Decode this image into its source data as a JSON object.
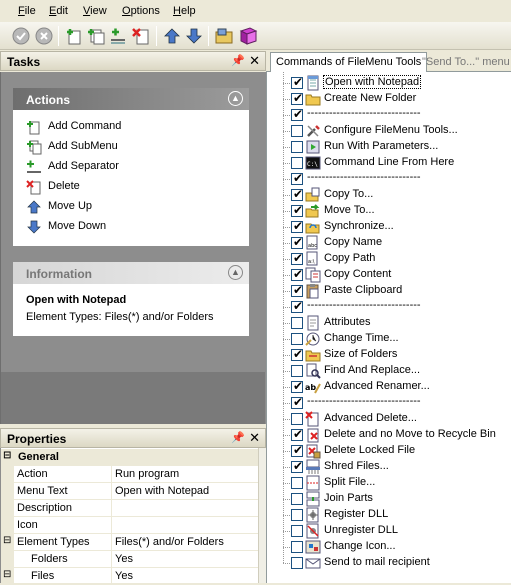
{
  "menu": {
    "items": [
      {
        "accel": "F",
        "rest": "ile"
      },
      {
        "accel": "E",
        "rest": "dit"
      },
      {
        "accel": "V",
        "rest": "iew"
      },
      {
        "accel": "O",
        "rest": "ptions"
      },
      {
        "accel": "H",
        "rest": "elp"
      }
    ]
  },
  "toolbar": {
    "buttons": [
      "apply-icon",
      "cancel-icon",
      "add-command-icon",
      "add-submenu-icon",
      "add-separator-icon",
      "delete-icon",
      "move-up-icon",
      "move-down-icon",
      "explorer-icon",
      "help-book-icon"
    ]
  },
  "tasks": {
    "title": "Tasks",
    "actions": {
      "title": "Actions",
      "items": [
        "Add Command",
        "Add SubMenu",
        "Add Separator",
        "Delete",
        "Move Up",
        "Move Down"
      ]
    },
    "information": {
      "title": "Information",
      "element_name": "Open with Notepad",
      "element_types": "Element Types: Files(*) and/or Folders"
    }
  },
  "properties": {
    "title": "Properties",
    "category": "General",
    "rows": [
      {
        "name": "Action",
        "value": "Run program"
      },
      {
        "name": "Menu Text",
        "value": "Open with Notepad"
      },
      {
        "name": "Description",
        "value": ""
      },
      {
        "name": "Icon",
        "value": ""
      },
      {
        "name": "Element Types",
        "value": "Files(*) and/or Folders"
      },
      {
        "name": "Folders",
        "value": "Yes"
      },
      {
        "name": "Files",
        "value": "Yes"
      }
    ]
  },
  "tabs": {
    "active": "Commands of FileMenu Tools",
    "inactive": "\"Send To...\" menu"
  },
  "tree": {
    "separator_text": "-------------------------------",
    "items": [
      {
        "label": "Open with Notepad",
        "checked": true,
        "icon": "notepad-icon",
        "selected": true
      },
      {
        "label": "Create New Folder",
        "checked": true,
        "icon": "folder-icon"
      },
      {
        "label": "",
        "checked": true,
        "separator": true
      },
      {
        "label": "Configure FileMenu Tools...",
        "checked": false,
        "icon": "tools-icon"
      },
      {
        "label": "Run With Parameters...",
        "checked": false,
        "icon": "run-icon"
      },
      {
        "label": "Command Line From Here",
        "checked": false,
        "icon": "console-icon"
      },
      {
        "label": "",
        "checked": true,
        "separator": true
      },
      {
        "label": "Copy To...",
        "checked": true,
        "icon": "copy-to-icon"
      },
      {
        "label": "Move To...",
        "checked": true,
        "icon": "move-to-icon"
      },
      {
        "label": "Synchronize...",
        "checked": true,
        "icon": "sync-icon"
      },
      {
        "label": "Copy Name",
        "checked": true,
        "icon": "copy-name-icon"
      },
      {
        "label": "Copy Path",
        "checked": true,
        "icon": "copy-path-icon"
      },
      {
        "label": "Copy Content",
        "checked": true,
        "icon": "copy-content-icon"
      },
      {
        "label": "Paste Clipboard",
        "checked": true,
        "icon": "paste-icon"
      },
      {
        "label": "",
        "checked": true,
        "separator": true
      },
      {
        "label": "Attributes",
        "checked": false,
        "icon": "attributes-icon"
      },
      {
        "label": "Change Time...",
        "checked": false,
        "icon": "time-icon"
      },
      {
        "label": "Size of Folders",
        "checked": true,
        "icon": "size-icon"
      },
      {
        "label": "Find And Replace...",
        "checked": false,
        "icon": "find-icon"
      },
      {
        "label": "Advanced Renamer...",
        "checked": true,
        "icon": "rename-icon"
      },
      {
        "label": "",
        "checked": true,
        "separator": true
      },
      {
        "label": "Advanced Delete...",
        "checked": false,
        "icon": "adv-delete-icon"
      },
      {
        "label": "Delete and no Move to Recycle Bin",
        "checked": true,
        "icon": "delete-no-bin-icon"
      },
      {
        "label": "Delete Locked File",
        "checked": true,
        "icon": "delete-locked-icon"
      },
      {
        "label": "Shred Files...",
        "checked": true,
        "icon": "shred-icon"
      },
      {
        "label": "Split File...",
        "checked": false,
        "icon": "split-icon"
      },
      {
        "label": "Join Parts",
        "checked": false,
        "icon": "join-icon"
      },
      {
        "label": "Register DLL",
        "checked": false,
        "icon": "register-dll-icon"
      },
      {
        "label": "Unregister DLL",
        "checked": false,
        "icon": "unregister-dll-icon"
      },
      {
        "label": "Change Icon...",
        "checked": false,
        "icon": "change-icon-icon"
      },
      {
        "label": "Send to mail recipient",
        "checked": false,
        "icon": "mail-icon"
      }
    ]
  }
}
